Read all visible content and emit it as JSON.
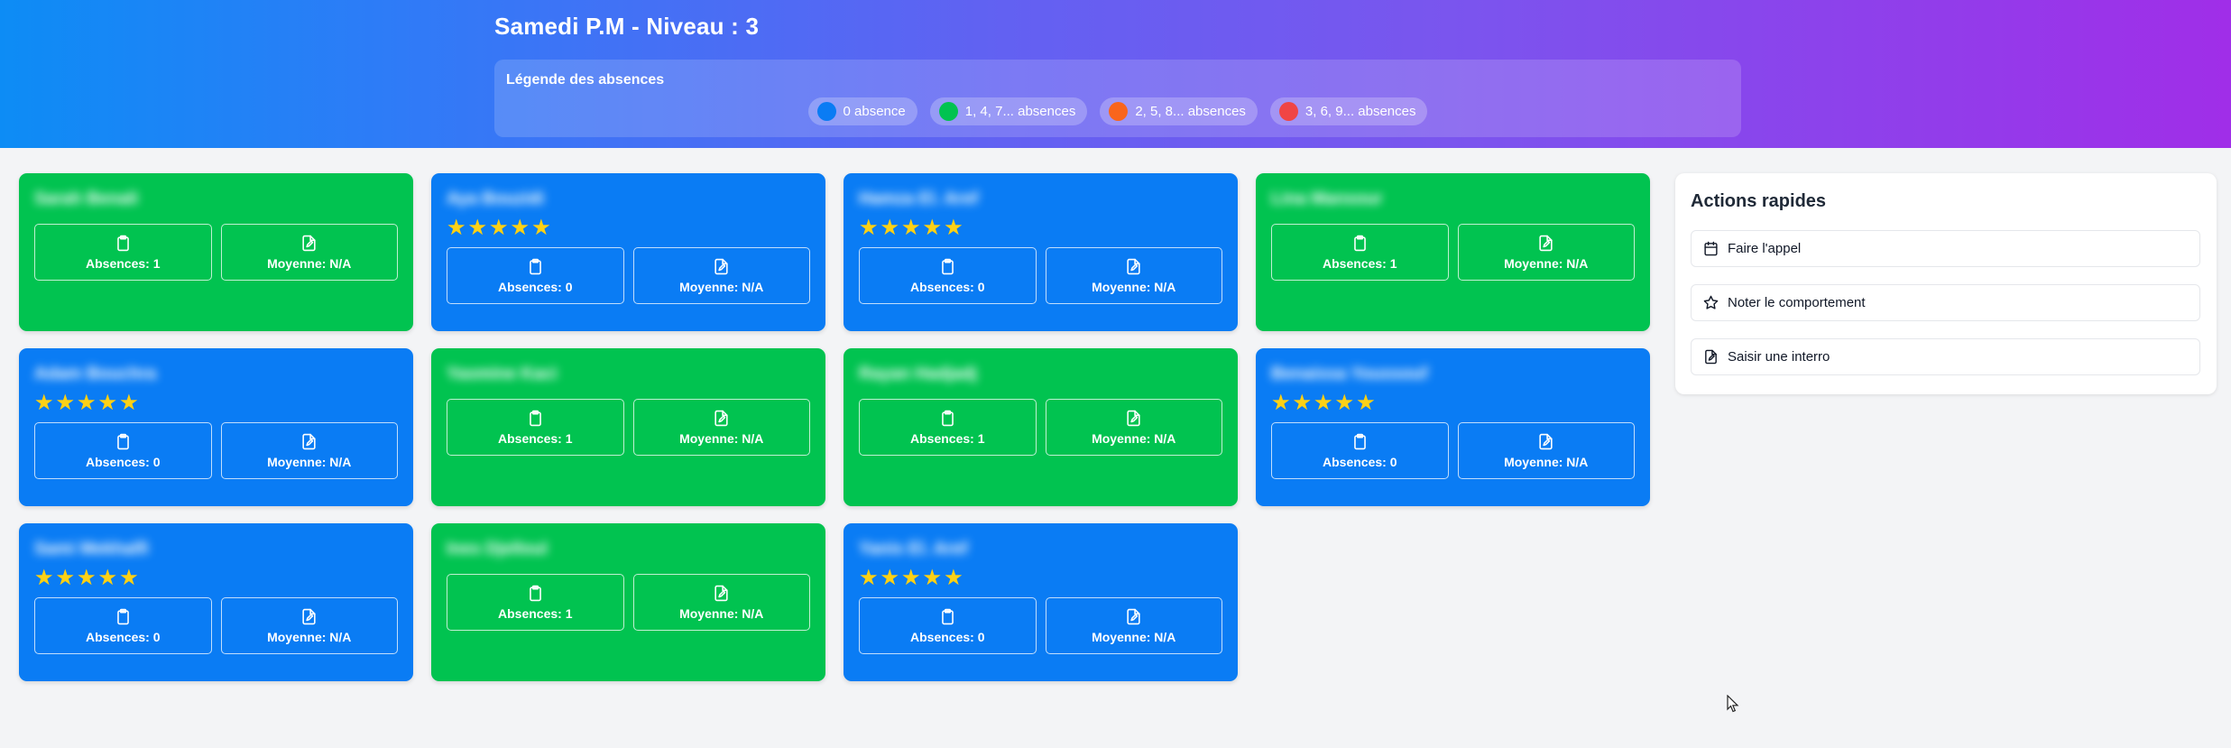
{
  "header": {
    "title": "Samedi P.M - Niveau : 3",
    "legend": {
      "title": "Légende des absences",
      "items": [
        {
          "label": "0 absence",
          "color": "#0a7cf4"
        },
        {
          "label": "1, 4, 7... absences",
          "color": "#01c350"
        },
        {
          "label": "2, 5, 8... absences",
          "color": "#f9651c"
        },
        {
          "label": "3, 6, 9... absences",
          "color": "#f04545"
        }
      ]
    }
  },
  "students": [
    {
      "name": "Sarah Benali",
      "color": "green",
      "stars": 0,
      "absences": "Absences: 1",
      "average": "Moyenne: N/A"
    },
    {
      "name": "Aya Bouzidi",
      "color": "blue",
      "stars": 5,
      "absences": "Absences: 0",
      "average": "Moyenne: N/A"
    },
    {
      "name": "Hamza El. Aref",
      "color": "blue",
      "stars": 5,
      "absences": "Absences: 0",
      "average": "Moyenne: N/A"
    },
    {
      "name": "Lina Mansour",
      "color": "green",
      "stars": 0,
      "absences": "Absences: 1",
      "average": "Moyenne: N/A"
    },
    {
      "name": "Adam Bouchra",
      "color": "blue",
      "stars": 5,
      "absences": "Absences: 0",
      "average": "Moyenne: N/A"
    },
    {
      "name": "Yasmine Kaci",
      "color": "green",
      "stars": 0,
      "absences": "Absences: 1",
      "average": "Moyenne: N/A"
    },
    {
      "name": "Rayan Hadjadj",
      "color": "green",
      "stars": 0,
      "absences": "Absences: 1",
      "average": "Moyenne: N/A"
    },
    {
      "name": "Benaissa Youssouf",
      "color": "blue",
      "stars": 5,
      "absences": "Absences: 0",
      "average": "Moyenne: N/A"
    },
    {
      "name": "Sami Mekhalfi",
      "color": "blue",
      "stars": 5,
      "absences": "Absences: 0",
      "average": "Moyenne: N/A"
    },
    {
      "name": "Ines Djelloul",
      "color": "green",
      "stars": 0,
      "absences": "Absences: 1",
      "average": "Moyenne: N/A"
    },
    {
      "name": "Yanis El. Aref",
      "color": "blue",
      "stars": 5,
      "absences": "Absences: 0",
      "average": "Moyenne: N/A"
    }
  ],
  "quick_actions": {
    "title": "Actions rapides",
    "items": [
      {
        "label": "Faire l'appel",
        "icon": "calendar-icon"
      },
      {
        "label": "Noter le comportement",
        "icon": "star-outline-icon"
      },
      {
        "label": "Saisir une interro",
        "icon": "file-edit-icon"
      }
    ]
  }
}
